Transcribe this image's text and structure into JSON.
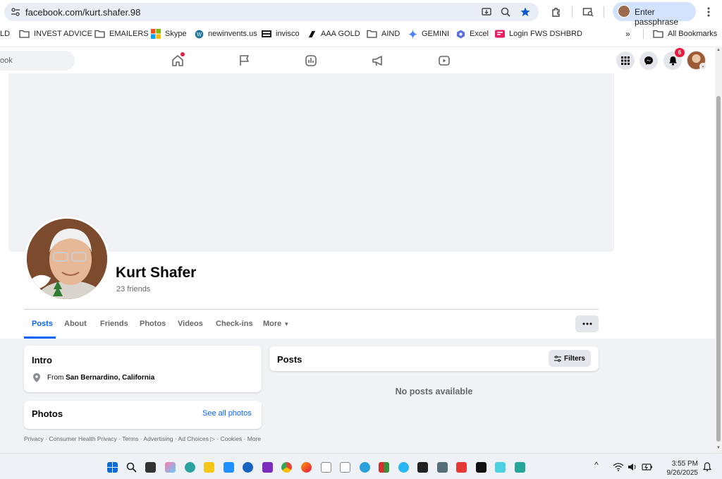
{
  "browser": {
    "url": "facebook.com/kurt.shafer.98",
    "passphrase_label": "Enter passphrase"
  },
  "bookmarks": [
    {
      "label": "LD",
      "icon": "folder-icon"
    },
    {
      "label": "INVEST ADVICE",
      "icon": "folder-icon"
    },
    {
      "label": "EMAILERS",
      "icon": "folder-icon"
    },
    {
      "label": "Skype",
      "icon": "microsoft-icon"
    },
    {
      "label": "newinvents.us",
      "icon": "wordpress-icon"
    },
    {
      "label": "invisco",
      "icon": "invisco-icon"
    },
    {
      "label": "AAA GOLD",
      "icon": "aaa-gold-icon"
    },
    {
      "label": "AIND",
      "icon": "folder-icon"
    },
    {
      "label": "GEMINI",
      "icon": "gemini-icon"
    },
    {
      "label": "Excel",
      "icon": "excel-icon"
    },
    {
      "label": "Login FWS DSHBRD",
      "icon": "fws-icon"
    }
  ],
  "all_bookmarks_label": "All Bookmarks",
  "fb_nav": {
    "search_placeholder": "ook",
    "notification_count": "6"
  },
  "profile": {
    "name": "Kurt Shafer",
    "friends": "23 friends"
  },
  "tabs": [
    "Posts",
    "About",
    "Friends",
    "Photos",
    "Videos",
    "Check-ins",
    "More"
  ],
  "intro": {
    "title": "Intro",
    "from_prefix": "From",
    "from_place": "San Bernardino, California"
  },
  "photos": {
    "title": "Photos",
    "see_all": "See all photos"
  },
  "posts": {
    "title": "Posts",
    "filters": "Filters",
    "empty": "No posts available"
  },
  "footer": {
    "links": "Privacy · Consumer Health Privacy · Terms · Advertising · Ad Choices ▷ · Cookies · More"
  },
  "taskbar": {
    "time": "3:55 PM",
    "date": "9/26/2025"
  },
  "colors": {
    "fb_blue": "#0866ff",
    "omnibox_bg": "#e9eef6",
    "passphrase_bg": "#d3e3fd",
    "page_bg": "#f0f2f5"
  }
}
